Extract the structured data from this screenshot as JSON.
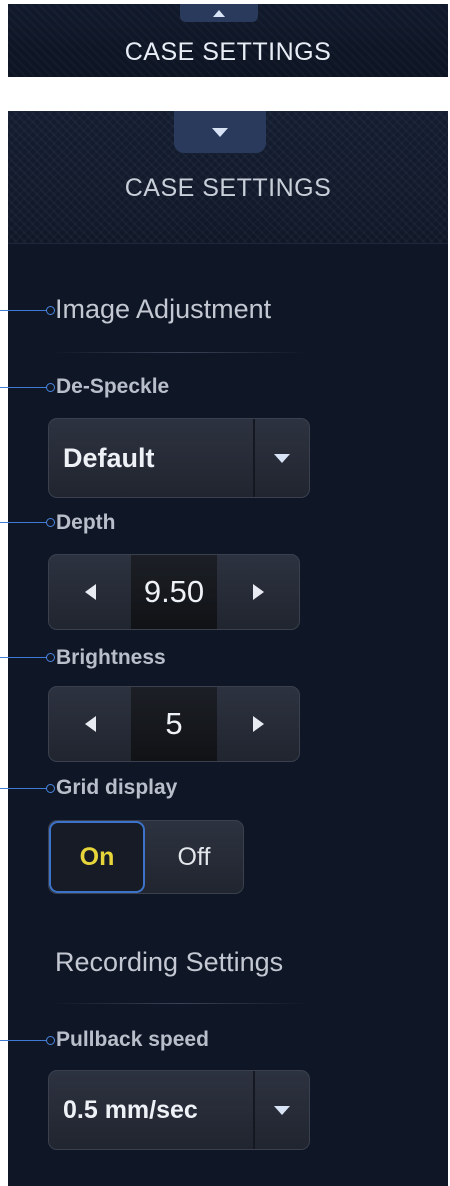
{
  "collapsed_header": {
    "title": "CASE SETTINGS",
    "toggle_icon": "triangle-up-icon"
  },
  "panel": {
    "title": "CASE SETTINGS",
    "toggle_icon": "triangle-down-icon",
    "image_adjustment": {
      "heading": "Image Adjustment",
      "despeckle": {
        "label": "De-Speckle",
        "value": "Default"
      },
      "depth": {
        "label": "Depth",
        "value": "9.50"
      },
      "brightness": {
        "label": "Brightness",
        "value": "5"
      },
      "grid_display": {
        "label": "Grid display",
        "on_label": "On",
        "off_label": "Off",
        "selected": "On"
      }
    },
    "recording_settings": {
      "heading": "Recording Settings",
      "pullback_speed": {
        "label": "Pullback speed",
        "value": "0.5 mm/sec"
      }
    }
  },
  "colors": {
    "accent_blue": "#3c73c8",
    "selected_text": "#e6d53a",
    "panel_bg": "#0f1626"
  }
}
